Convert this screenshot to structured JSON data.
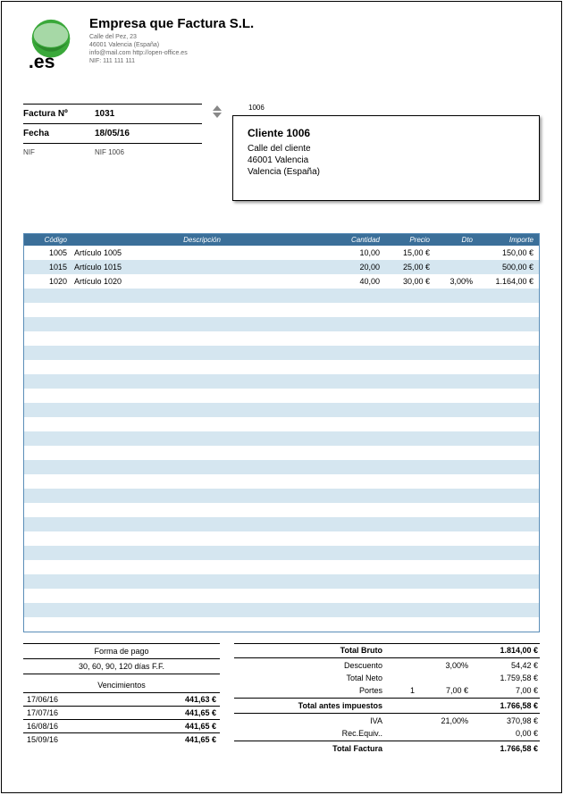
{
  "company": {
    "name": "Empresa que Factura S.L.",
    "addr1": "Calle del Pez, 23",
    "addr2": "46001 Valencia (España)",
    "contact": "info@mail.com  http://open-office.es",
    "nif": "NIF: 111 111 111"
  },
  "meta": {
    "invoice_label": "Factura Nº",
    "invoice_no": "1031",
    "date_label": "Fecha",
    "date": "18/05/16",
    "nif_label": "NIF",
    "nif_value": "NIF 1006"
  },
  "client": {
    "num": "1006",
    "name": "Cliente 1006",
    "addr1": "Calle del cliente",
    "addr2": "46001 Valencia",
    "addr3": "Valencia (España)"
  },
  "columns": {
    "code": "Código",
    "desc": "Descripción",
    "qty": "Cantidad",
    "price": "Precio",
    "dto": "Dto",
    "imp": "Importe"
  },
  "items": [
    {
      "code": "1005",
      "desc": "Artículo 1005",
      "qty": "10,00",
      "price": "15,00 €",
      "dto": "",
      "imp": "150,00 €"
    },
    {
      "code": "1015",
      "desc": "Artículo 1015",
      "qty": "20,00",
      "price": "25,00 €",
      "dto": "",
      "imp": "500,00 €"
    },
    {
      "code": "1020",
      "desc": "Artículo 1020",
      "qty": "40,00",
      "price": "30,00 €",
      "dto": "3,00%",
      "imp": "1.164,00 €"
    }
  ],
  "empty_rows": 24,
  "payment": {
    "forma_label": "Forma de pago",
    "forma_value": "30, 60, 90, 120 días F.F.",
    "venc_label": "Vencimientos",
    "venc": [
      {
        "date": "17/06/16",
        "amount": "441,63 €"
      },
      {
        "date": "17/07/16",
        "amount": "441,65 €"
      },
      {
        "date": "16/08/16",
        "amount": "441,65 €"
      },
      {
        "date": "15/09/16",
        "amount": "441,65 €"
      }
    ]
  },
  "totals": {
    "bruto_label": "Total Bruto",
    "bruto": "1.814,00 €",
    "desc_label": "Descuento",
    "desc_pct": "3,00%",
    "desc": "54,42 €",
    "neto_label": "Total Neto",
    "neto": "1.759,58 €",
    "portes_label": "Portes",
    "portes_q": "1",
    "portes_unit": "7,00 €",
    "portes": "7,00 €",
    "antes_label": "Total antes impuestos",
    "antes": "1.766,58 €",
    "iva_label": "IVA",
    "iva_pct": "21,00%",
    "iva": "370,98 €",
    "rec_label": "Rec.Equiv..",
    "rec": "0,00 €",
    "total_label": "Total Factura",
    "total": "1.766,58 €"
  }
}
